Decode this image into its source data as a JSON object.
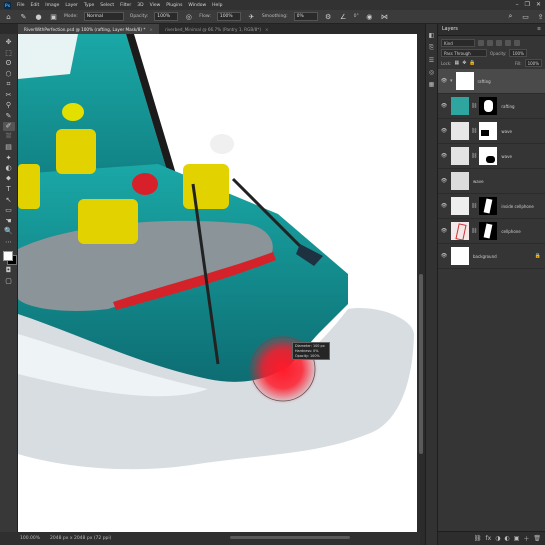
{
  "app": {
    "logo_text": "Ps"
  },
  "menu": [
    "File",
    "Edit",
    "Image",
    "Layer",
    "Type",
    "Select",
    "Filter",
    "3D",
    "View",
    "Plugins",
    "Window",
    "Help"
  ],
  "window_controls": [
    "–",
    "❐",
    "✕"
  ],
  "options": {
    "mode_label": "Mode:",
    "mode_value": "Normal",
    "opacity_label": "Opacity:",
    "opacity_value": "100%",
    "flow_label": "Flow:",
    "flow_value": "100%",
    "smoothing_label": "Smoothing:",
    "smoothing_value": "0%",
    "angle_value": "0°"
  },
  "tabs": [
    {
      "label": "RiverWithPerfection.psd @ 100% (rafting, Layer Mask/8) *",
      "active": true
    },
    {
      "label": "riverbed_Minimal @ 66.7% (Pantry 1, RGB/8*)",
      "active": false
    }
  ],
  "tools": [
    "✥",
    "⬚",
    "ʘ",
    "⬡",
    "⌗",
    "✂",
    "⚲",
    "✎",
    "✐",
    "⛆",
    "▤",
    "✦",
    "◐",
    "⬥",
    "T",
    "↖",
    "▭",
    "☚",
    "🔍",
    "⋯"
  ],
  "colors": {
    "foreground": "#ffffff",
    "background": "#000000",
    "accent_blue": "#31a8ff",
    "brush_red": "#ff1a2a"
  },
  "status": {
    "zoom": "100.00%",
    "doc_info": "2048 px x 2048 px (72 ppi)"
  },
  "strip_icons": [
    "◧",
    "⎘",
    "☰",
    "◎",
    "▦"
  ],
  "layers_panel": {
    "title": "Layers",
    "filter_label": "Kind",
    "blend_mode": "Pass Through",
    "opacity_label": "Opacity:",
    "opacity_value": "100%",
    "lock_label": "Lock:",
    "fill_label": "Fill:",
    "fill_value": "100%",
    "layers": [
      {
        "name": "rafting",
        "type": "group",
        "selected": true
      },
      {
        "name": "rafting",
        "type": "masked",
        "selected": false
      },
      {
        "name": "wave",
        "type": "masked",
        "selected": false
      },
      {
        "name": "wave",
        "type": "masked",
        "selected": false
      },
      {
        "name": "wave",
        "type": "plain",
        "selected": false
      },
      {
        "name": "inside cellphone",
        "type": "masked",
        "selected": false
      },
      {
        "name": "cellphone",
        "type": "masked",
        "selected": false
      },
      {
        "name": "background",
        "type": "plain",
        "selected": false
      }
    ],
    "footer_icons": [
      "⛓",
      "fx",
      "◑",
      "◐",
      "▣",
      "＋",
      "🗑"
    ]
  },
  "brush_tooltip": {
    "diameter": "Diameter: 100 px",
    "hardness": "Hardness: 0%",
    "opacity": "Opacity: 100%"
  }
}
